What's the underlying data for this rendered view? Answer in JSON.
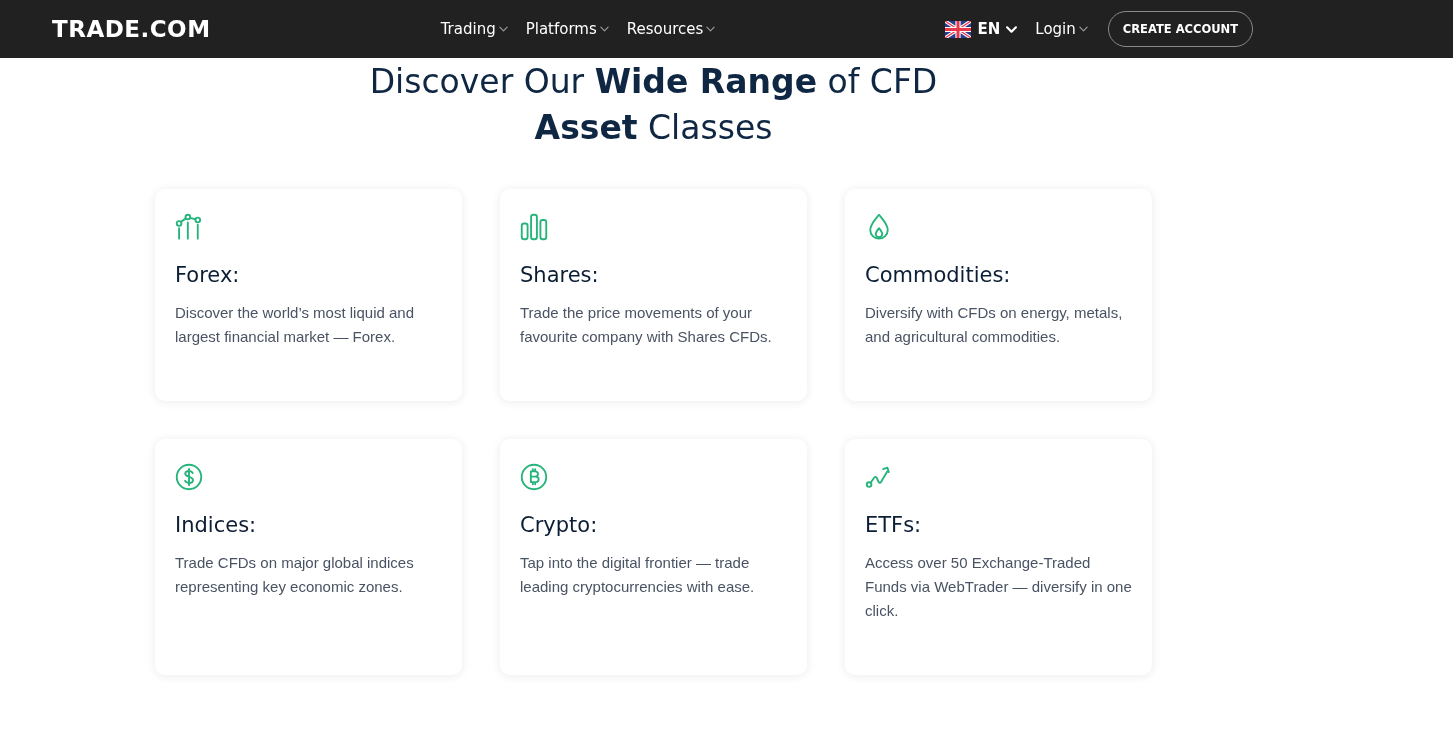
{
  "nav": {
    "logo": "TRADE.COM",
    "menu": [
      "Trading",
      "Platforms",
      "Resources"
    ],
    "language": "EN",
    "login": "Login",
    "cta": "CREATE ACCOUNT"
  },
  "section": {
    "title": "Discover Our **Wide Range** of CFD **Asset** Classes",
    "cards": [
      {
        "title": "Forex:",
        "description": "Discover the world’s most liquid and largest financial market — Forex."
      },
      {
        "title": "Shares:",
        "description": "Trade the price movements of your favourite company with Shares CFDs."
      },
      {
        "title": "Commodities:",
        "description": "Diversify with CFDs on energy, metals, and agricultural commodities."
      },
      {
        "title": "Indices:",
        "description": "Trade CFDs on major global indices representing key economic zones."
      },
      {
        "title": "Crypto:",
        "description": "Tap into the digital frontier — trade leading cryptocurrencies with ease."
      },
      {
        "title": "ETFs:",
        "description": "Access over 50 Exchange-Traded Funds via WebTrader — diversify in one click."
      }
    ]
  }
}
